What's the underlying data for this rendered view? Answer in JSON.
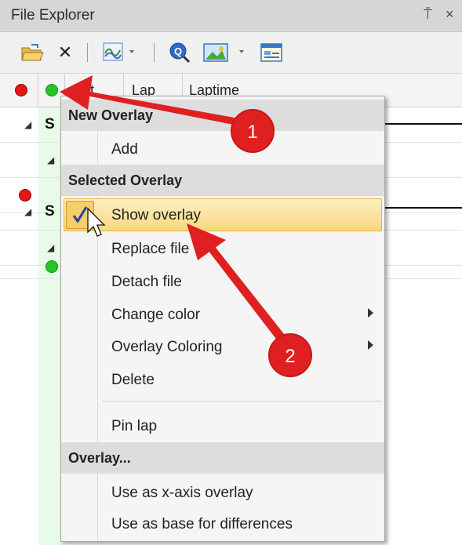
{
  "window": {
    "title": "File Explorer",
    "pin_glyph": "⍑",
    "close_glyph": "×"
  },
  "toolbar": {
    "items": [
      {
        "name": "open-folder-icon"
      },
      {
        "name": "delete-icon",
        "glyph": "✕"
      },
      {
        "name": "overlay-wave-icon"
      },
      {
        "name": "zoom-icon"
      },
      {
        "name": "image-chart-icon"
      },
      {
        "name": "report-icon"
      }
    ]
  },
  "table": {
    "columns": [
      "Out",
      "Lap",
      "Laptime"
    ],
    "row_labels": [
      "S",
      "S"
    ]
  },
  "context_menu": {
    "new_overlay_header": "New Overlay",
    "add": "Add",
    "selected_overlay_header": "Selected Overlay",
    "show_overlay": "Show overlay",
    "show_overlay_checked": true,
    "replace_file": "Replace file",
    "detach_file": "Detach file",
    "change_color": "Change color",
    "overlay_coloring": "Overlay Coloring",
    "delete": "Delete",
    "pin_lap": "Pin lap",
    "overlay_header": "Overlay...",
    "use_as_x_axis": "Use as x-axis overlay",
    "use_as_base": "Use as base for differences"
  },
  "callouts": [
    {
      "label": "1",
      "color": "#e02020"
    },
    {
      "label": "2",
      "color": "#e02020"
    }
  ],
  "colors": {
    "accent_red": "#e02020",
    "status_green": "#26c426",
    "status_red": "#e01818",
    "highlight": "#f8d77e"
  }
}
